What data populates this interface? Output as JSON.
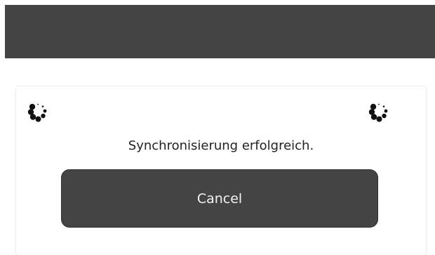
{
  "header": {
    "background_color": "#444444"
  },
  "dialog": {
    "status_text": "Synchronisierung erfolgreich.",
    "cancel_label": "Cancel",
    "spinner_icon": "loading-spinner-icon",
    "button_color": "#444444"
  }
}
